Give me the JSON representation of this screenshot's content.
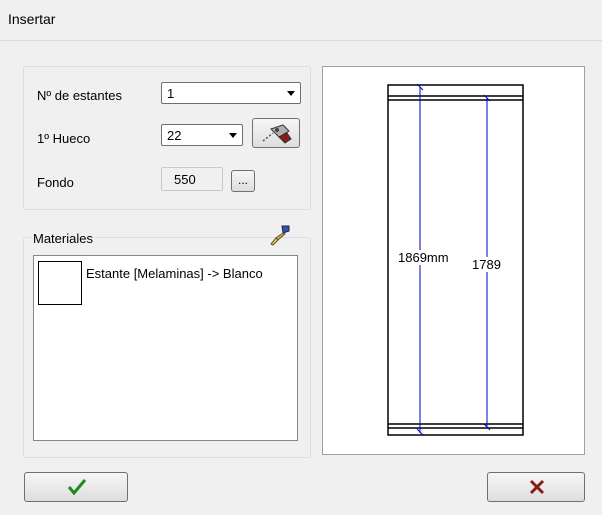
{
  "window": {
    "title": "Insertar"
  },
  "settings": {
    "shelves_label": "Nº de estantes",
    "shelves_value": "1",
    "first_gap_label": "1º Hueco",
    "first_gap_value": "22",
    "depth_label": "Fondo",
    "depth_value": "550",
    "depth_button_label": "..."
  },
  "materials": {
    "label": "Materiales",
    "items": [
      {
        "text": "Estante [Melaminas] -> Blanco"
      }
    ]
  },
  "preview": {
    "total_height_label": "1869mm",
    "inner_height_label": "1789",
    "line_color": "#0000cc"
  },
  "buttons": {
    "ok_icon": "checkmark-icon",
    "cancel_icon": "x-icon",
    "ok_color": "#1e8a1e",
    "cancel_color": "#8b1a1a"
  }
}
